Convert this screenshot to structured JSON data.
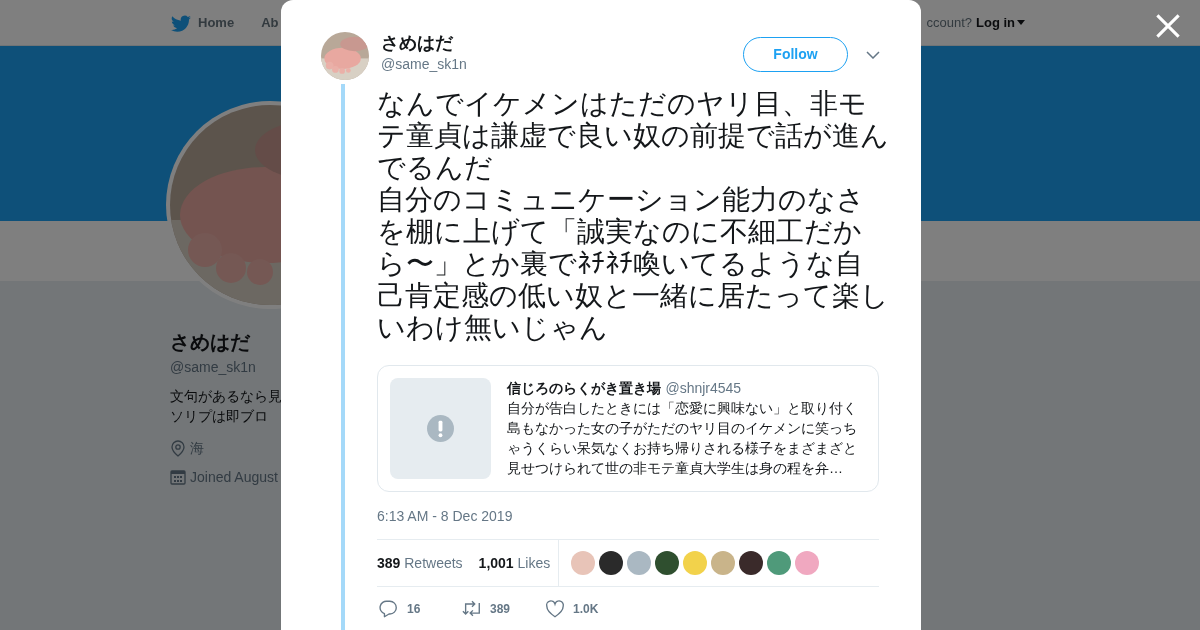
{
  "background_page": {
    "nav": {
      "items": [
        "Home",
        "Ab"
      ],
      "account_prompt": "ccount?",
      "login": "Log in"
    },
    "profile": {
      "name": "さめはだ",
      "handle": "@same_sk1n",
      "bio_lines": [
        "文句があるなら見",
        "ソリプは即ブロ"
      ],
      "location": "海",
      "joined": "Joined August"
    }
  },
  "tweet": {
    "author": {
      "name": "さめはだ",
      "handle": "@same_sk1n"
    },
    "follow_button": "Follow",
    "paragraphs": [
      "なんでイケメンはただのヤリ目、非モテ童貞は謙虚で良い奴の前提で話が進んでるんだ",
      "自分のコミュニケーション能力のなさを棚に上げて「誠実なのに不細工だから〜」とか裏でﾈﾁﾈﾁ喚いてるような自己肯定感の低い奴と一緒に居たって楽しいわけ無いじゃん"
    ],
    "quoted": {
      "name": "信じろのらくがき置き場",
      "handle": "@shnjr4545",
      "text": "自分が告白したときには「恋愛に興味ない」と取り付く島もなかった女の子がただのヤリ目のイケメンに笑っちゃうくらい呆気なくお持ち帰りされる様子をまざまざと見せつけられて世の非モテ童貞大学生は身の程を弁…"
    },
    "timestamp": "6:13 AM - 8 Dec 2019",
    "stats": [
      {
        "count": "389",
        "label": "Retweets"
      },
      {
        "count": "1,001",
        "label": "Likes"
      }
    ],
    "liker_avatars": [
      {
        "color": "#e8c4b8"
      },
      {
        "color": "#2a2a2a"
      },
      {
        "color": "#aab8c2"
      },
      {
        "color": "#2f4f2f"
      },
      {
        "color": "#f2d24b"
      },
      {
        "color": "#c9b48a"
      },
      {
        "color": "#3a2a2a"
      },
      {
        "color": "#4f9a7a"
      },
      {
        "color": "#f0a8c0"
      }
    ],
    "actions": [
      {
        "kind": "reply",
        "count": "16"
      },
      {
        "kind": "retweet",
        "count": "389"
      },
      {
        "kind": "like",
        "count": "1.0K"
      }
    ]
  }
}
